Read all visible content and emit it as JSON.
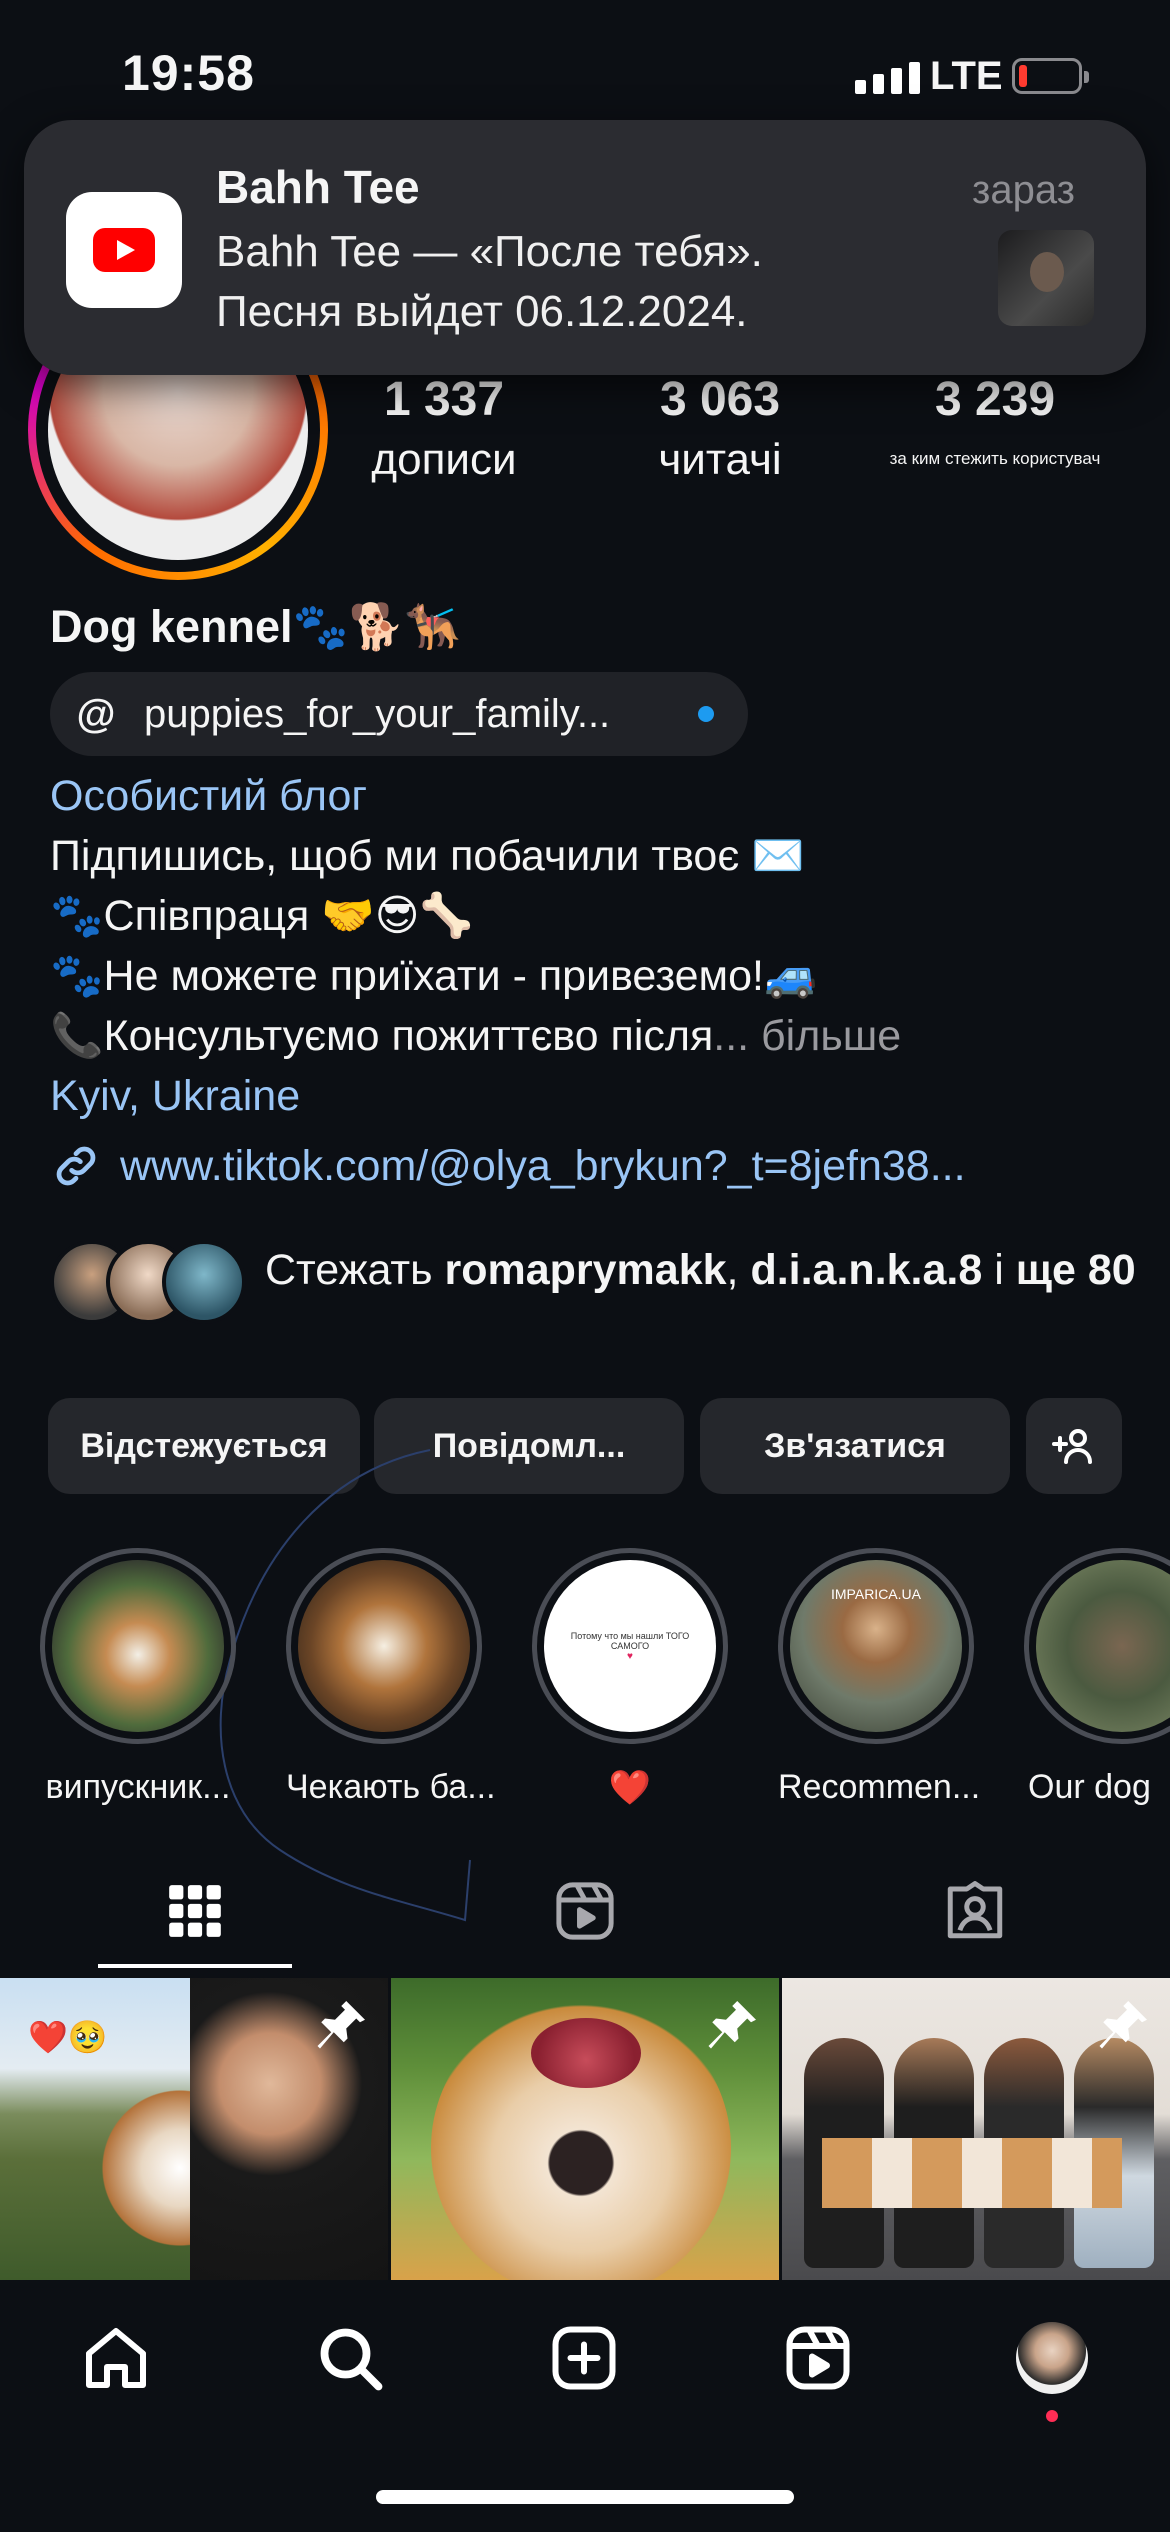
{
  "status_bar": {
    "time": "19:58",
    "network": "LTE"
  },
  "notification": {
    "app_icon": "youtube-icon",
    "title": "Bahh Tee",
    "body_line1": "Bahh Tee — «После тебя».",
    "body_line2": "Песня выйдет 06.12.2024.",
    "time": "зараз"
  },
  "profile": {
    "stats": [
      {
        "value": "1 337",
        "label": "дописи"
      },
      {
        "value": "3 063",
        "label": "читачі"
      },
      {
        "value": "3 239",
        "label": "за ким стежить користувач"
      }
    ],
    "name": "Dog kennel",
    "name_emoji": "🐾🐕🐕‍🦺",
    "threads_handle": "puppies_for_your_family...",
    "category": "Особистий блог",
    "bio_lines": [
      "Підпишись, щоб ми побачили твоє ✉️",
      "🐾Співпраця 🤝😎🦴",
      "🐾Не можете приїхати - привеземо!🚙",
      "📞Консультуємо пожиттєво після"
    ],
    "bio_more": "більше",
    "location": "Kyiv, Ukraine",
    "link": "www.tiktok.com/@olya_brykun?_t=8jefn38...",
    "followed_by_prefix": "Стежать ",
    "followed_by_user1": "romaprymakk",
    "followed_by_sep1": ", ",
    "followed_by_user2": "d.i.a.n.k.a.8",
    "followed_by_sep2": " і ",
    "followed_by_more": "ще 80"
  },
  "buttons": {
    "following": "Відстежується",
    "message": "Повідомл...",
    "contact": "Зв'язатися"
  },
  "highlights": [
    {
      "label": "випускник..."
    },
    {
      "label": "Чекають ба..."
    },
    {
      "label": "❤️",
      "card_text": "Потому что мы нашли ТОГО САМОГО"
    },
    {
      "label": "Recommen...",
      "overlay_text": "IMPARICA.UA"
    },
    {
      "label": "Our dog"
    }
  ],
  "posts": [
    {
      "caption_emoji": "❤️🥹",
      "pinned": true
    },
    {
      "pinned": true
    },
    {
      "pinned": true
    }
  ],
  "tabs": [
    "grid-icon",
    "reels-icon",
    "tagged-icon"
  ],
  "nav": [
    "home-icon",
    "search-icon",
    "create-icon",
    "reels-icon",
    "profile-avatar"
  ]
}
